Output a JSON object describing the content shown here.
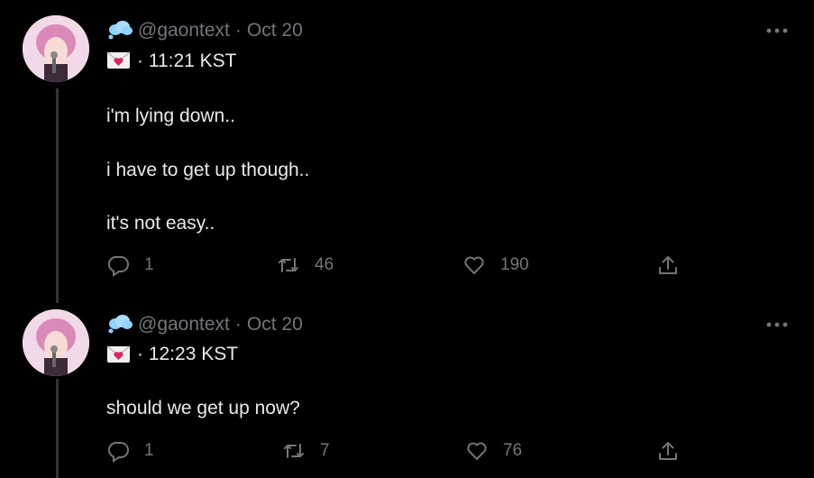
{
  "tweets": [
    {
      "handle": "@gaontext",
      "separator": "·",
      "date": "Oct 20",
      "time_text": "· 11:21 KST",
      "lines": [
        "i'm lying down..",
        "i have to get up though..",
        "it's not easy.."
      ],
      "replies": "1",
      "retweets": "46",
      "likes": "190"
    },
    {
      "handle": "@gaontext",
      "separator": "·",
      "date": "Oct 20",
      "time_text": "· 12:23 KST",
      "lines": [
        "should we get up now?"
      ],
      "replies": "1",
      "retweets": "7",
      "likes": "76"
    }
  ],
  "icons": {
    "cloud": "cloud-emoji-icon",
    "envelope": "love-letter-icon",
    "more": "more-options-icon",
    "reply": "reply-icon",
    "retweet": "retweet-icon",
    "like": "like-icon",
    "share": "share-icon"
  },
  "colors": {
    "background": "#000000",
    "text": "#e7e9ea",
    "secondary": "#71767b",
    "thread_line": "#333639",
    "heart_red": "#e0245e"
  }
}
